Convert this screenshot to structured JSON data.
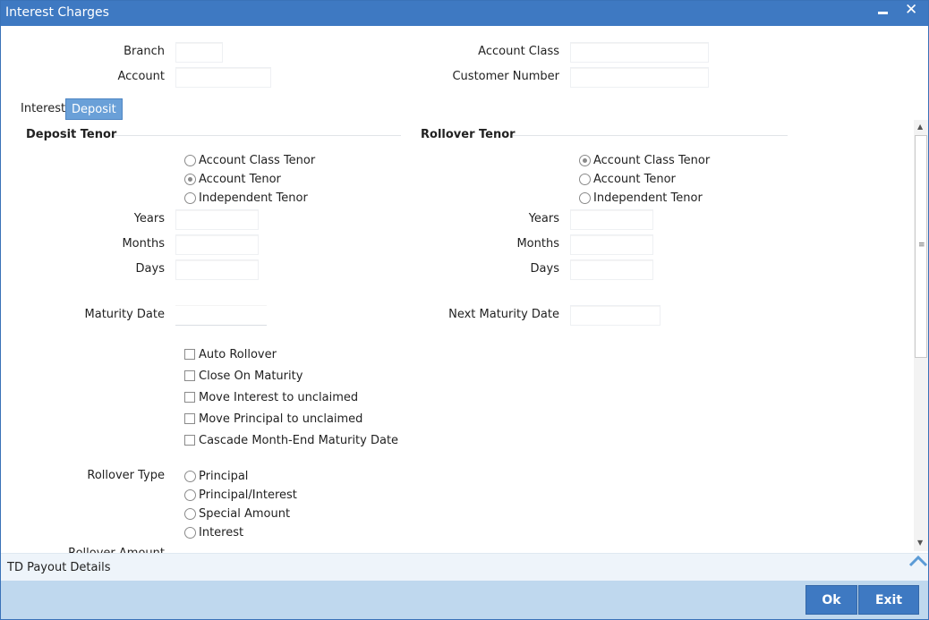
{
  "window": {
    "title": "Interest Charges"
  },
  "header": {
    "branch_label": "Branch",
    "account_label": "Account",
    "account_class_label": "Account Class",
    "customer_number_label": "Customer Number"
  },
  "tabs": [
    {
      "label": "Interest",
      "active": false
    },
    {
      "label": "Deposit",
      "active": true
    }
  ],
  "deposit_tenor": {
    "title": "Deposit Tenor",
    "options": [
      {
        "label": "Account Class Tenor",
        "selected": false
      },
      {
        "label": "Account Tenor",
        "selected": true
      },
      {
        "label": "Independent Tenor",
        "selected": false
      }
    ],
    "years_label": "Years",
    "months_label": "Months",
    "days_label": "Days",
    "maturity_date_label": "Maturity Date"
  },
  "rollover_tenor": {
    "title": "Rollover Tenor",
    "options": [
      {
        "label": "Account Class Tenor",
        "selected": true
      },
      {
        "label": "Account Tenor",
        "selected": false
      },
      {
        "label": "Independent Tenor",
        "selected": false
      }
    ],
    "years_label": "Years",
    "months_label": "Months",
    "days_label": "Days",
    "next_maturity_date_label": "Next Maturity Date"
  },
  "checkboxes": [
    {
      "label": "Auto Rollover",
      "checked": false
    },
    {
      "label": "Close On Maturity",
      "checked": false
    },
    {
      "label": "Move Interest to unclaimed",
      "checked": false
    },
    {
      "label": "Move Principal to unclaimed",
      "checked": false
    },
    {
      "label": "Cascade Month-End Maturity Date",
      "checked": false
    }
  ],
  "rollover_type": {
    "label": "Rollover Type",
    "options": [
      {
        "label": "Principal",
        "selected": false
      },
      {
        "label": "Principal/Interest",
        "selected": false
      },
      {
        "label": "Special Amount",
        "selected": false
      },
      {
        "label": "Interest",
        "selected": false
      }
    ]
  },
  "rollover_amount_label": "Rollover Amount",
  "payout": {
    "label": "TD Payout Details"
  },
  "footer": {
    "ok_label": "Ok",
    "exit_label": "Exit"
  }
}
